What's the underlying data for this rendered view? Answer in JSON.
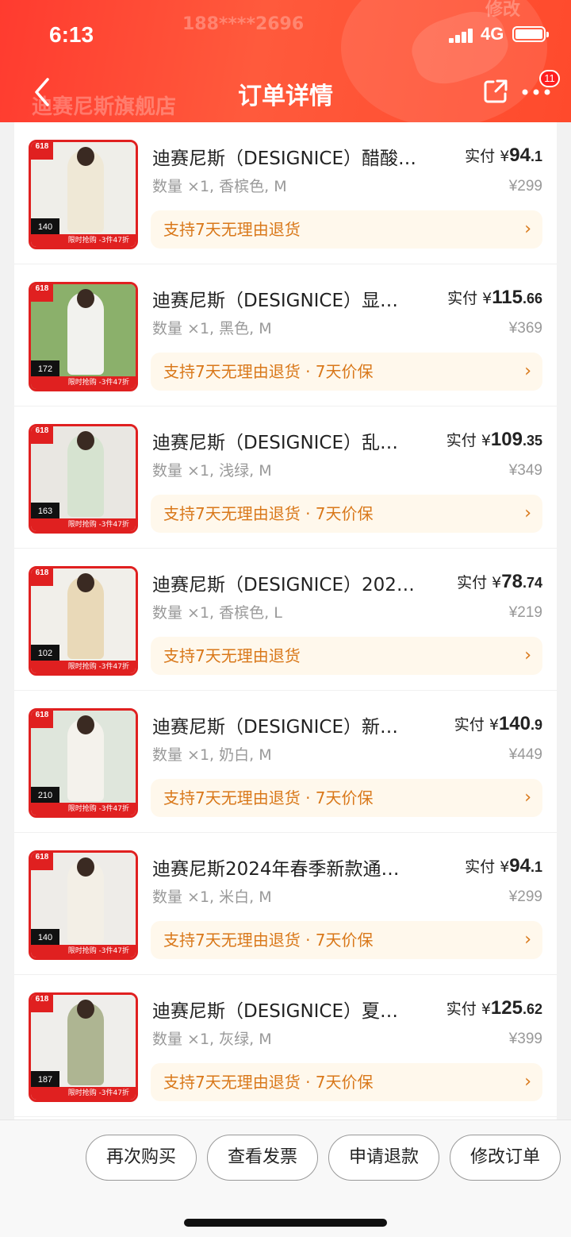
{
  "status_bar": {
    "time": "6:13",
    "network": "4G"
  },
  "nav": {
    "title": "订单详情",
    "badge_count": "11"
  },
  "header_ghost": {
    "store_name": "迪赛尼斯旗舰店",
    "phone_masked": "188****2696",
    "edit_label": "修改"
  },
  "items": [
    {
      "title": "迪赛尼斯（DESIGNICE）醋酸…",
      "paid_label": "实付",
      "paid_symbol": "¥",
      "paid_int": "94",
      "paid_dec": ".1",
      "spec": "数量 ×1, 香槟色, M",
      "original_price": "¥299",
      "policy": "支持7天无理由退货",
      "thumb_price": "140",
      "thumb_bg": "#efeee9",
      "cloth": "#efe8d6"
    },
    {
      "title": "迪赛尼斯（DESIGNICE）显…",
      "paid_label": "实付",
      "paid_symbol": "¥",
      "paid_int": "115",
      "paid_dec": ".66",
      "spec": "数量 ×1, 黑色, M",
      "original_price": "¥369",
      "policy": "支持7天无理由退货 · 7天价保",
      "thumb_price": "172",
      "thumb_bg": "#8bb06b",
      "cloth": "#f2f2ee"
    },
    {
      "title": "迪赛尼斯（DESIGNICE）乱…",
      "paid_label": "实付",
      "paid_symbol": "¥",
      "paid_int": "109",
      "paid_dec": ".35",
      "spec": "数量 ×1, 浅绿, M",
      "original_price": "¥349",
      "policy": "支持7天无理由退货 · 7天价保",
      "thumb_price": "163",
      "thumb_bg": "#e9e7e2",
      "cloth": "#d6e3d0"
    },
    {
      "title": "迪赛尼斯（DESIGNICE）202…",
      "paid_label": "实付",
      "paid_symbol": "¥",
      "paid_int": "78",
      "paid_dec": ".74",
      "spec": "数量 ×1, 香槟色, L",
      "original_price": "¥219",
      "policy": "支持7天无理由退货",
      "thumb_price": "102",
      "thumb_bg": "#f1efea",
      "cloth": "#e9d9b8"
    },
    {
      "title": "迪赛尼斯（DESIGNICE）新…",
      "paid_label": "实付",
      "paid_symbol": "¥",
      "paid_int": "140",
      "paid_dec": ".9",
      "spec": "数量 ×1, 奶白, M",
      "original_price": "¥449",
      "policy": "支持7天无理由退货 · 7天价保",
      "thumb_price": "210",
      "thumb_bg": "#dfe6dc",
      "cloth": "#f4f2ec"
    },
    {
      "title": "迪赛尼斯2024年春季新款通…",
      "paid_label": "实付",
      "paid_symbol": "¥",
      "paid_int": "94",
      "paid_dec": ".1",
      "spec": "数量 ×1, 米白, M",
      "original_price": "¥299",
      "policy": "支持7天无理由退货 · 7天价保",
      "thumb_price": "140",
      "thumb_bg": "#eeece8",
      "cloth": "#f3efe6"
    },
    {
      "title": "迪赛尼斯（DESIGNICE）夏…",
      "paid_label": "实付",
      "paid_symbol": "¥",
      "paid_int": "125",
      "paid_dec": ".62",
      "spec": "数量 ×1, 灰绿, M",
      "original_price": "¥399",
      "policy": "支持7天无理由退货 · 7天价保",
      "thumb_price": "187",
      "thumb_bg": "#efeeeb",
      "cloth": "#aeb592"
    }
  ],
  "thumb_badge": "618",
  "thumb_strip": "限时抢购 -3件47折",
  "bottom_buttons": [
    "再次购买",
    "查看发票",
    "申请退款",
    "修改订单"
  ],
  "colors": {
    "header": "#ff4a2c",
    "policy_text": "#d9781a",
    "policy_bg": "#fff8ec",
    "thumb_border": "#e02020"
  }
}
